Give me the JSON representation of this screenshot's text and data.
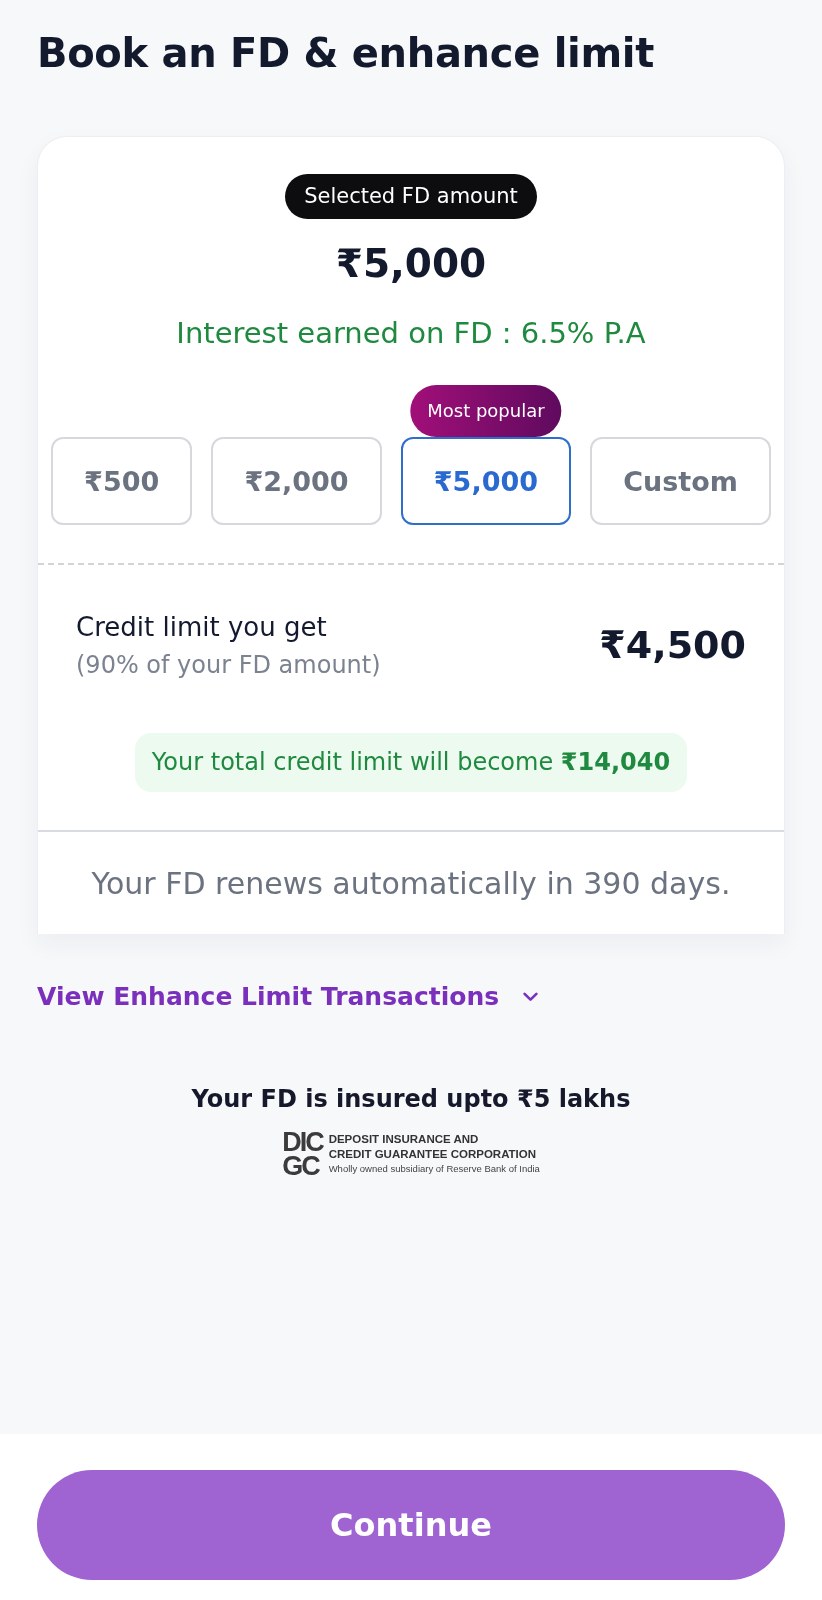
{
  "title": "Book an FD & enhance limit",
  "fd_card": {
    "badge": "Selected FD amount",
    "amount": "₹5,000",
    "interest": "Interest earned on FD : 6.5% P.A",
    "options": [
      {
        "label": "₹500",
        "selected": false
      },
      {
        "label": "₹2,000",
        "selected": false
      },
      {
        "label": "₹5,000",
        "selected": true,
        "tag": "Most popular"
      },
      {
        "label": "Custom",
        "selected": false
      }
    ],
    "credit": {
      "label": "Credit limit you get",
      "note": "(90% of your FD amount)",
      "amount": "₹4,500"
    },
    "total_banner": "Your total credit limit will become **₹14,040**",
    "renewal": "Your FD renews automatically in 390 days."
  },
  "transactions_link": {
    "label": "View Enhance Limit Transactions",
    "expanded": false
  },
  "insurance": {
    "title": "Your FD is insured upto ₹5 lakhs",
    "logo": {
      "mark_lines": [
        "DIC",
        "GC"
      ],
      "name_lines": [
        "DEPOSIT INSURANCE AND",
        "CREDIT GUARANTEE CORPORATION"
      ],
      "subtitle": "Wholly owned subsidiary of Reserve Bank of India"
    }
  },
  "primary_button": "Continue"
}
